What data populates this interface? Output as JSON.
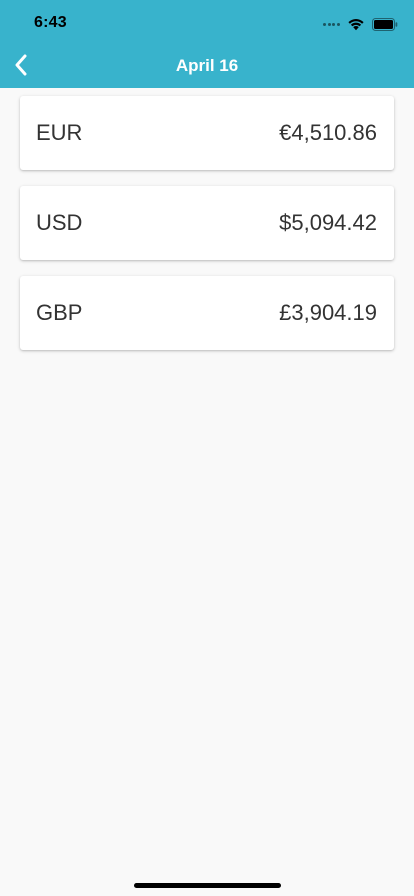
{
  "status_bar": {
    "time": "6:43"
  },
  "header": {
    "title": "April 16",
    "back_icon": "chevron-left-icon",
    "background": "#38b3cc"
  },
  "balances": [
    {
      "code": "EUR",
      "amount": "€4,510.86"
    },
    {
      "code": "USD",
      "amount": "$5,094.42"
    },
    {
      "code": "GBP",
      "amount": "£3,904.19"
    }
  ]
}
